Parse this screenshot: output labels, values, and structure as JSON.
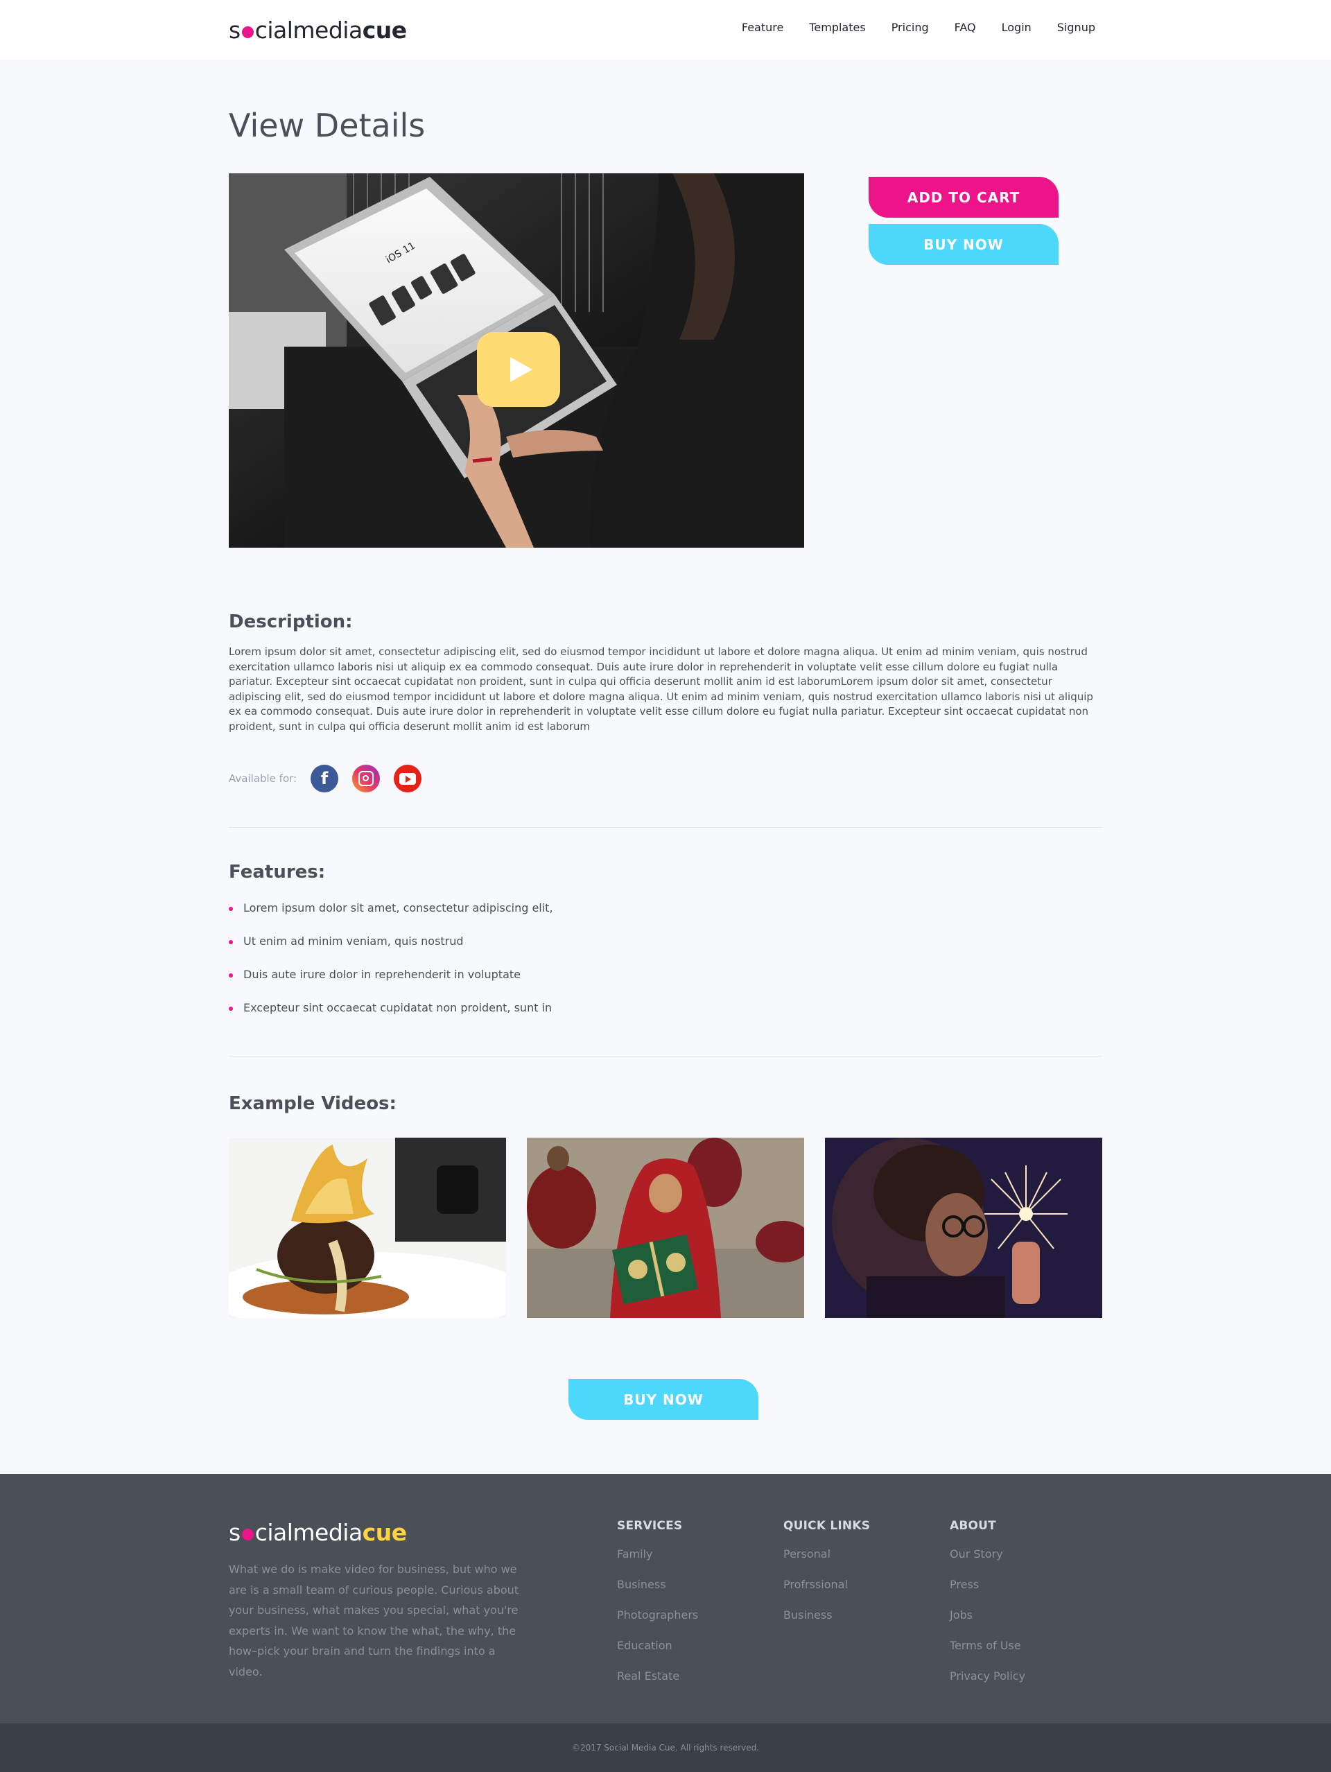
{
  "header": {
    "logo": {
      "prefix": "s",
      "suffix": "cialmedia",
      "bold": "cue"
    },
    "nav": [
      "Feature",
      "Templates",
      "Pricing",
      "FAQ",
      "Login",
      "Signup"
    ]
  },
  "main": {
    "title": "View Details",
    "hero": {
      "screen_title": "iOS 11",
      "play_icon": "play-icon"
    },
    "add_to_cart": "ADD TO CART",
    "buy_now": "BUY NOW",
    "description_title": "Description:",
    "description": "Lorem ipsum dolor sit amet, consectetur adipiscing elit, sed do eiusmod tempor incididunt ut labore et dolore magna aliqua. Ut enim ad minim veniam, quis nostrud exercitation ullamco laboris nisi ut aliquip ex ea commodo consequat. Duis aute irure dolor in reprehenderit in voluptate velit esse cillum dolore eu fugiat nulla pariatur. Excepteur sint occaecat cupidatat non proident, sunt in culpa qui officia deserunt mollit anim id est laborumLorem ipsum dolor sit amet, consectetur adipiscing elit, sed do eiusmod tempor incididunt ut labore et dolore magna aliqua. Ut enim ad minim veniam, quis nostrud exercitation ullamco laboris nisi ut aliquip ex ea commodo consequat. Duis aute irure dolor in reprehenderit in voluptate velit esse cillum dolore eu fugiat nulla pariatur. Excepteur sint occaecat cupidatat non proident, sunt in culpa qui officia deserunt mollit anim id est laborum",
    "available_label": "Available for:",
    "available_icons": [
      "facebook-icon",
      "instagram-icon",
      "youtube-icon"
    ],
    "features_title": "Features:",
    "features": [
      "Lorem ipsum dolor sit amet, consectetur adipiscing elit,",
      "Ut enim ad minim veniam, quis nostrud",
      "Duis aute irure dolor in reprehenderit in voluptate",
      "Excepteur sint occaecat cupidatat non proident, sunt in"
    ],
    "examples_title": "Example Videos:",
    "buy_now_bottom": "BUY NOW"
  },
  "footer": {
    "logo": {
      "prefix": "s",
      "suffix": "cialmedia",
      "bold": "cue"
    },
    "about": "What we do is make video for business, but who we are is a small team of curious people. Curious about your business, what makes you special, what you're experts in. We want to know the what, the why, the how–pick your brain and turn the findings into a video.",
    "services": {
      "title": "SERVICES",
      "links": [
        "Family",
        "Business",
        "Photographers",
        "Education",
        "Real Estate"
      ]
    },
    "quick_links": {
      "title": "QUICK LINKS",
      "links": [
        "Personal",
        "Profrssional",
        "Business"
      ]
    },
    "about_col": {
      "title": "ABOUT",
      "links": [
        "Our Story",
        "Press",
        "Jobs",
        "Terms of Use",
        "Privacy Policy"
      ]
    },
    "copyright": "©2017 Social Media Cue. All rights reserved."
  },
  "colors": {
    "accent_pink": "#ec1488",
    "accent_cyan": "#4dd7fb",
    "play_yellow": "#ffdc73",
    "footer_bg": "#4a4f58"
  }
}
